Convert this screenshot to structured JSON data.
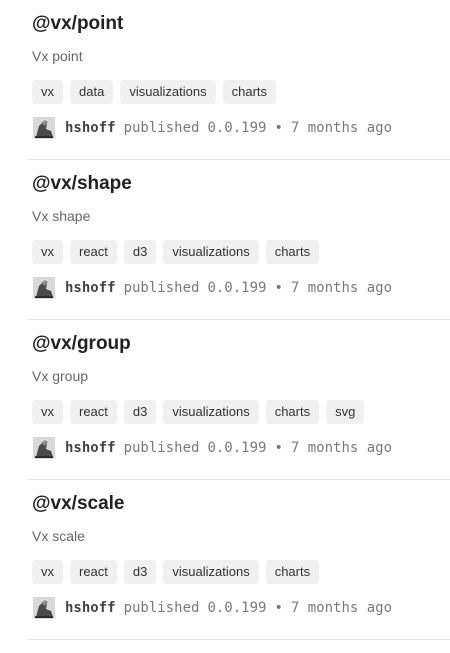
{
  "packages": [
    {
      "name": "@vx/point",
      "description": "Vx point",
      "keywords": [
        "vx",
        "data",
        "visualizations",
        "charts"
      ],
      "author": "hshoff",
      "published_text": "published",
      "version": "0.0.199",
      "separator": "•",
      "time_ago": "7 months ago"
    },
    {
      "name": "@vx/shape",
      "description": "Vx shape",
      "keywords": [
        "vx",
        "react",
        "d3",
        "visualizations",
        "charts"
      ],
      "author": "hshoff",
      "published_text": "published",
      "version": "0.0.199",
      "separator": "•",
      "time_ago": "7 months ago"
    },
    {
      "name": "@vx/group",
      "description": "Vx group",
      "keywords": [
        "vx",
        "react",
        "d3",
        "visualizations",
        "charts",
        "svg"
      ],
      "author": "hshoff",
      "published_text": "published",
      "version": "0.0.199",
      "separator": "•",
      "time_ago": "7 months ago"
    },
    {
      "name": "@vx/scale",
      "description": "Vx scale",
      "keywords": [
        "vx",
        "react",
        "d3",
        "visualizations",
        "charts"
      ],
      "author": "hshoff",
      "published_text": "published",
      "version": "0.0.199",
      "separator": "•",
      "time_ago": "7 months ago"
    }
  ]
}
